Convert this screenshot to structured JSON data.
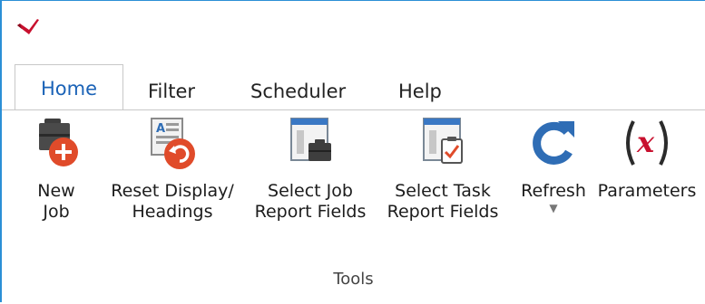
{
  "tabs": [
    {
      "label": "Home",
      "active": true
    },
    {
      "label": "Filter"
    },
    {
      "label": "Scheduler"
    },
    {
      "label": "Help"
    }
  ],
  "ribbon": {
    "buttons": [
      {
        "label": "New\nJob",
        "icon": "new-job-icon"
      },
      {
        "label": "Reset Display/\nHeadings",
        "icon": "reset-display-icon"
      },
      {
        "label": "Select Job\nReport Fields",
        "icon": "select-job-report-fields-icon"
      },
      {
        "label": "Select Task\nReport Fields",
        "icon": "select-task-report-fields-icon"
      },
      {
        "label": "Refresh",
        "icon": "refresh-icon",
        "dropdown": true
      },
      {
        "label": "Parameters",
        "icon": "parameters-icon"
      }
    ],
    "group_label": "Tools"
  },
  "colors": {
    "accent": "#1b63b7",
    "badge_red": "#e04b2a",
    "frame_blue": "#2b8fd6"
  }
}
